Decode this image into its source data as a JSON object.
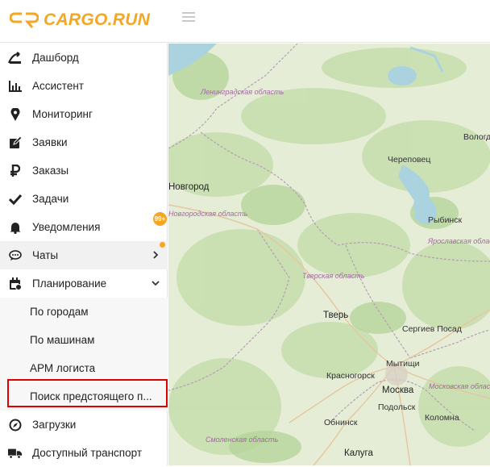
{
  "app": {
    "logo_text": "CARGO.RUN"
  },
  "menu": {
    "items": [
      {
        "label": "Дашборд",
        "icon": "dashboard-icon"
      },
      {
        "label": "Ассистент",
        "icon": "bar-chart-icon"
      },
      {
        "label": "Мониторинг",
        "icon": "map-pin-icon"
      },
      {
        "label": "Заявки",
        "icon": "edit-icon"
      },
      {
        "label": "Заказы",
        "icon": "ruble-icon"
      },
      {
        "label": "Задачи",
        "icon": "check-icon"
      },
      {
        "label": "Уведомления",
        "icon": "bell-icon",
        "badge": "99+"
      },
      {
        "label": "Чаты",
        "icon": "chat-icon"
      },
      {
        "label": "Планирование",
        "icon": "calendar-icon"
      },
      {
        "label": "Загрузки",
        "icon": "compass-icon"
      },
      {
        "label": "Доступный транспорт",
        "icon": "truck-icon"
      }
    ],
    "planning_sub": [
      {
        "label": "По городам"
      },
      {
        "label": "По машинам"
      },
      {
        "label": "АРМ логиста"
      },
      {
        "label": "Поиск предстоящего п..."
      }
    ]
  },
  "map": {
    "regions": [
      {
        "text": "Ленинградская область"
      },
      {
        "text": "Новгородская область"
      },
      {
        "text": "Тверская область"
      },
      {
        "text": "Ярославская область"
      },
      {
        "text": "Московская область"
      },
      {
        "text": "Смоленская область"
      }
    ],
    "cities": [
      {
        "text": "Новгород"
      },
      {
        "text": "Череповец"
      },
      {
        "text": "Вологда"
      },
      {
        "text": "Рыбинск"
      },
      {
        "text": "Тверь"
      },
      {
        "text": "Сергиев Посад"
      },
      {
        "text": "Мытищи"
      },
      {
        "text": "Красногорск"
      },
      {
        "text": "Москва"
      },
      {
        "text": "Подольск"
      },
      {
        "text": "Обнинск"
      },
      {
        "text": "Коломна"
      },
      {
        "text": "Калуга"
      }
    ]
  },
  "colors": {
    "accent": "#f5a623",
    "highlight": "#e00000"
  }
}
